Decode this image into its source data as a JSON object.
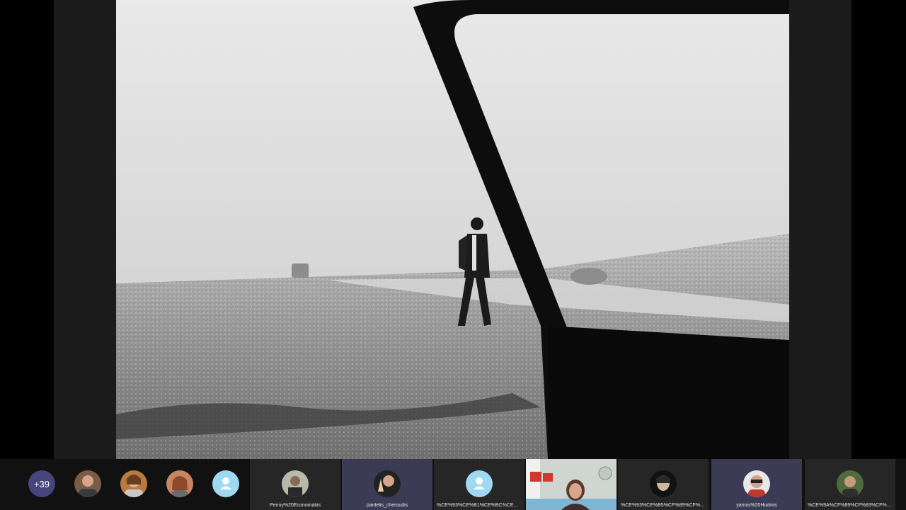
{
  "overflow_count": "+39",
  "participants": [
    {
      "name": "Penny%20Economakis"
    },
    {
      "name": "pantelis_cheroudis"
    },
    {
      "name": "%CE%93%CE%B1%CE%BC%CE%B7%CE%BB%CE%B1..."
    },
    {
      "name": "%CE%93%CE%B5%CF%89%CF%81%CE%B3%CE%B9..."
    },
    {
      "name": "yannis%20Hodinis"
    },
    {
      "name": "%CE%9A%CF%89%CF%83%CF%84%CE%B1..."
    }
  ],
  "colors": {
    "background": "#000000",
    "strip": "#111111",
    "active_tile": "#3b3b55",
    "overflow_badge": "#46457e",
    "placeholder_avatar": "#9fd8f2"
  }
}
